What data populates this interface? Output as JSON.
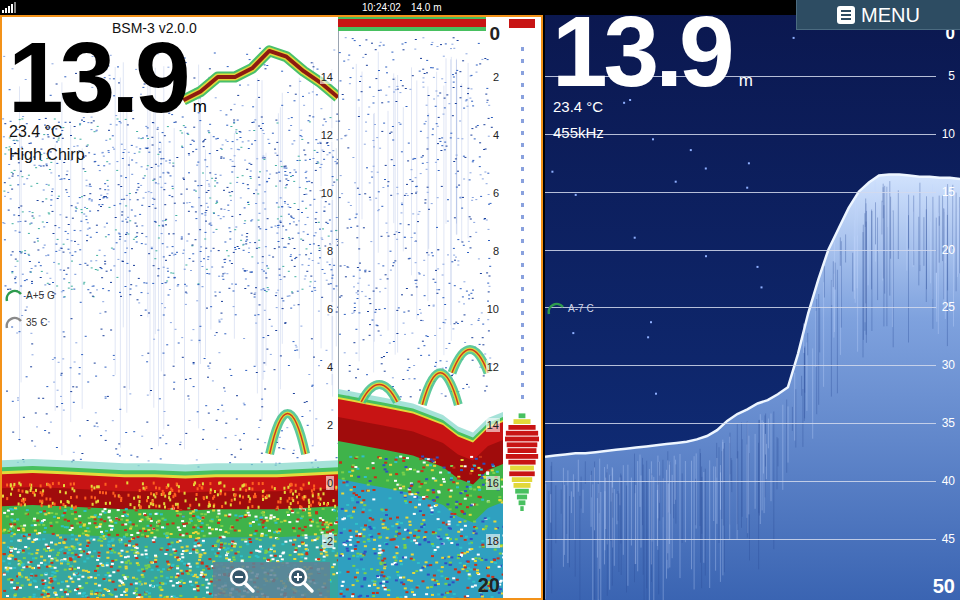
{
  "status_bar": {
    "time": "10:24:02",
    "depth": "14.0 m"
  },
  "menu_button": {
    "label": "MENU"
  },
  "left_panel": {
    "depth": "13.9",
    "unit": "m",
    "temperature": "23.4 °C",
    "mode": "High Chirp",
    "version": "BSM-3 v2.0.0",
    "gauges": [
      {
        "value": "A+5",
        "mode": "G",
        "color": "#2e9b4e"
      },
      {
        "value": "35",
        "mode": "C",
        "color": "#8a8a8a"
      }
    ],
    "zoom_view": {
      "ticks": [
        "14",
        "12",
        "10",
        "8",
        "6",
        "4",
        "2",
        "0",
        "-2"
      ],
      "bottom_profile": [
        0.3,
        0.35,
        0.3,
        0.25,
        0.2,
        0.2,
        0.15,
        0.2,
        0.2,
        0.2,
        0.25,
        0.3
      ],
      "upper_trace": {
        "start": 0.54,
        "values": [
          13.2,
          13.5,
          14.0,
          14.0,
          14.3,
          14.9,
          14.7,
          14.2,
          13.8,
          13.3
        ]
      },
      "fish_echoes": [
        {
          "x": 0.85,
          "top": 2.4,
          "bottom": 1.0
        }
      ]
    },
    "main_view": {
      "top_label": "0",
      "ticks": [
        "2",
        "4",
        "6",
        "8",
        "10",
        "12",
        "14",
        "16",
        "18"
      ],
      "range": "20",
      "bottom_profile": [
        13.1,
        13.2,
        13.3,
        13.4,
        13.5,
        13.6,
        13.8,
        14.0,
        14.4,
        14.6,
        14.1,
        13.9
      ],
      "fish_echoes": [
        {
          "x": 0.25,
          "top": 12.6,
          "bottom": 13.2
        },
        {
          "x": 0.62,
          "top": 12.2,
          "bottom": 13.3
        },
        {
          "x": 0.8,
          "top": 11.4,
          "bottom": 12.2
        }
      ]
    },
    "a_scope": {
      "start_depth": 13.6,
      "step": 0.2,
      "levels": [
        0.2,
        0.5,
        0.8,
        0.95,
        1,
        0.9,
        0.85,
        0.95,
        0.8,
        0.7,
        0.75,
        0.6,
        0.5,
        0.4,
        0.3,
        0.2,
        0.1
      ]
    }
  },
  "right_panel": {
    "depth": "13.9",
    "unit": "m",
    "temperature": "23.4 °C",
    "frequency": "455kHz",
    "gauges": [
      {
        "value": "A-7",
        "mode": "C",
        "color": "#2e9b4e"
      }
    ],
    "top_label": "0",
    "ticks": [
      "5",
      "10",
      "15",
      "20",
      "25",
      "30",
      "35",
      "40",
      "45"
    ],
    "range": "50",
    "bottom_profile": [
      37.9,
      37.8,
      37.7,
      37.6,
      37.6,
      37.5,
      37.4,
      37.3,
      37.2,
      37.1,
      37.0,
      36.9,
      36.8,
      36.7,
      36.6,
      36.4,
      36.1,
      35.6,
      34.8,
      34.2,
      33.8,
      33.3,
      33.0,
      32.5,
      31.9,
      29.0,
      25.5,
      22.6,
      20.0,
      18.2,
      16.4,
      15.0,
      14.2,
      13.6,
      13.5,
      13.5,
      13.6,
      13.7,
      13.7,
      13.8,
      13.8,
      13.9
    ]
  }
}
